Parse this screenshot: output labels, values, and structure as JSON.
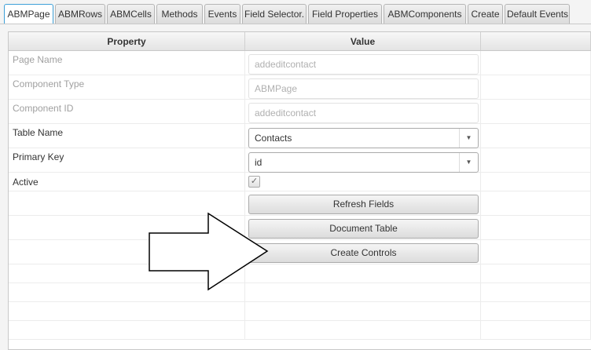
{
  "tabs": [
    {
      "label": "ABMPage",
      "active": true
    },
    {
      "label": "ABMRows"
    },
    {
      "label": "ABMCells"
    },
    {
      "label": "Methods"
    },
    {
      "label": "Events"
    },
    {
      "label": "Field Selector."
    },
    {
      "label": "Field Properties"
    },
    {
      "label": "ABMComponents"
    },
    {
      "label": "Create"
    },
    {
      "label": "Default Events"
    }
  ],
  "table": {
    "headers": {
      "property": "Property",
      "value": "Value"
    },
    "rows": [
      {
        "label": "Page Name",
        "value": "addeditcontact"
      },
      {
        "label": "Component Type",
        "value": "ABMPage"
      },
      {
        "label": "Component ID",
        "value": "addeditcontact"
      },
      {
        "label": "Table Name",
        "value": "Contacts"
      },
      {
        "label": "Primary Key",
        "value": "id"
      },
      {
        "label": "Active",
        "checked": "✓"
      }
    ],
    "buttons": {
      "refresh": "Refresh Fields",
      "document": "Document Table",
      "create": "Create Controls"
    }
  },
  "icons": {
    "dropdown": "▼"
  }
}
